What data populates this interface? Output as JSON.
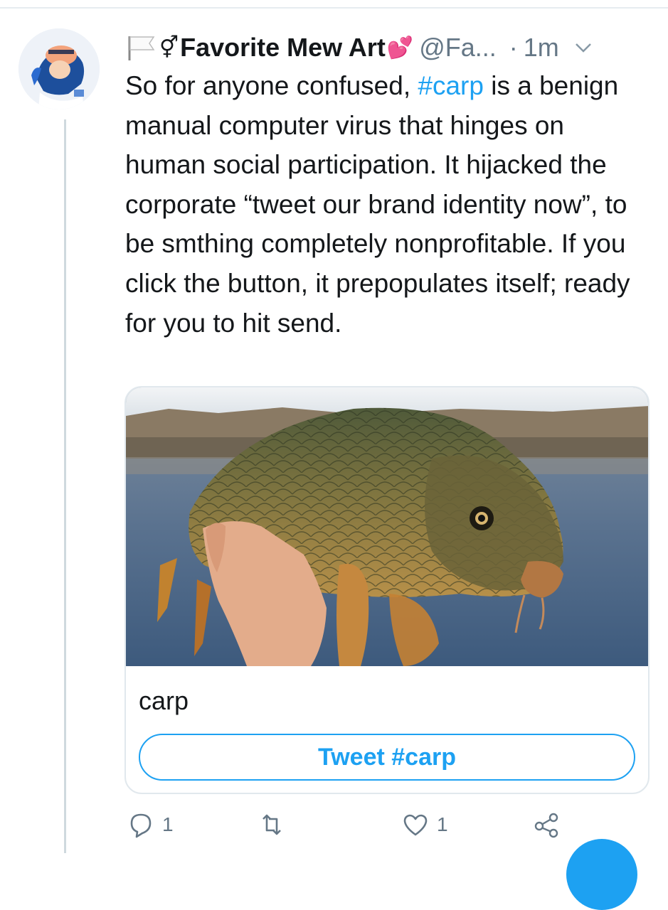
{
  "header": {
    "display_name": "Favorite Mew Art",
    "gender_symbol": "⚥",
    "heart_symbol": "💕",
    "handle": "@Fa...",
    "separator": "·",
    "time": "1m"
  },
  "tweet": {
    "segments": [
      {
        "text": "So for anyone confused, ",
        "hashtag": false
      },
      {
        "text": "#carp",
        "hashtag": true
      },
      {
        "text": " is a benign manual computer virus that hinges on human social participation. It hijacked the corporate “tweet our brand identity now”, to be smthing completely nonprofitable. If you click the button, it prepopulates itself; ready for you to hit send.",
        "hashtag": false
      }
    ]
  },
  "card": {
    "title": "carp",
    "button_label": "Tweet #carp"
  },
  "actions": {
    "reply_count": "1",
    "retweet_count": "",
    "like_count": "1"
  },
  "colors": {
    "accent": "#1da1f2",
    "text": "#14171a",
    "muted": "#657786"
  },
  "icons": [
    "flag-icon",
    "caret-down-icon",
    "reply-icon",
    "retweet-icon",
    "like-icon",
    "share-icon"
  ]
}
